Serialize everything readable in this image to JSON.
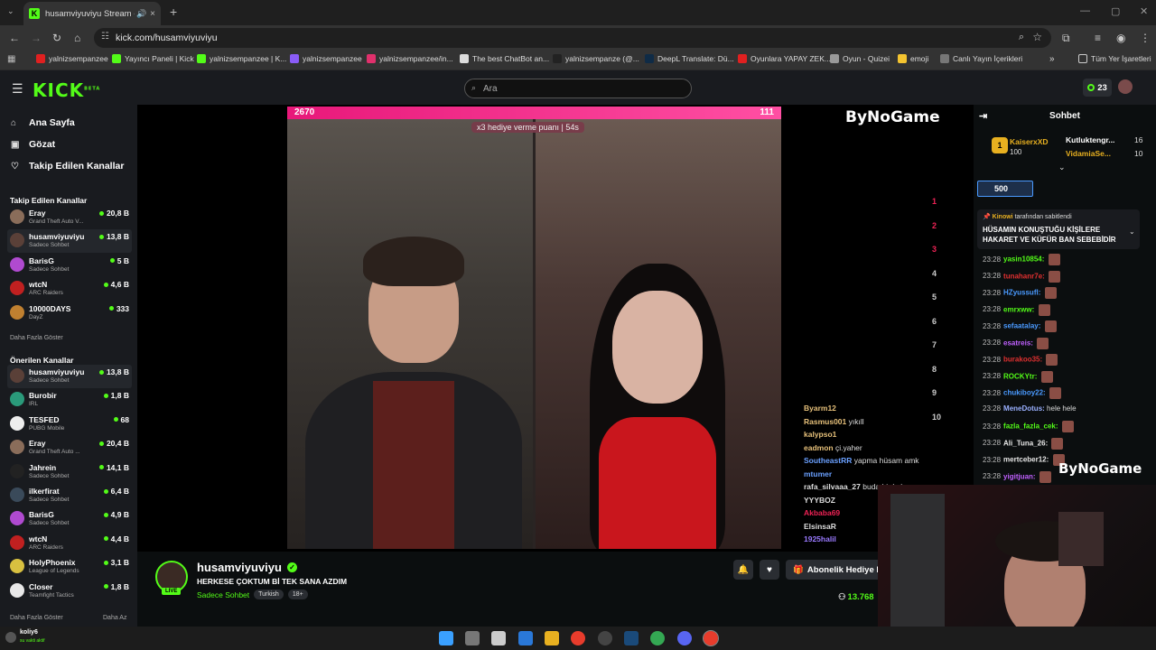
{
  "browser": {
    "tab_title": "husamviyuviyu Stream - W",
    "tab_close": "×",
    "new_tab": "+",
    "url": "kick.com/husamviyuviyu",
    "bookmarks": [
      {
        "label": "yalnizsempanzee",
        "color": "#e02020"
      },
      {
        "label": "Yayıncı Paneli | Kick",
        "color": "#53fc18"
      },
      {
        "label": "yalnizsempanzee | K...",
        "color": "#53fc18"
      },
      {
        "label": "yalnizsempanzee",
        "color": "#8a5cf6"
      },
      {
        "label": "yalnizsempanzee/in...",
        "color": "#e1306c"
      },
      {
        "label": "The best ChatBot an...",
        "color": "#dddddd"
      },
      {
        "label": "yalnizsempanze (@...",
        "color": "#222222"
      },
      {
        "label": "DeepL Translate: Dü...",
        "color": "#0f2b46"
      },
      {
        "label": "Oyunlara YAPAY ZEK...",
        "color": "#e02020"
      },
      {
        "label": "Oyun - Quizei",
        "color": "#999999"
      },
      {
        "label": "emoji",
        "color": "#f4c430"
      },
      {
        "label": "Canlı Yayın İçerikleri",
        "color": "#777777"
      }
    ],
    "all_bookmarks": "Tüm Yer İşaretleri"
  },
  "header": {
    "logo": "KICK",
    "search_placeholder": "Ara",
    "points": "23"
  },
  "sidebar": {
    "nav": [
      {
        "label": "Ana Sayfa",
        "icon": "home-icon"
      },
      {
        "label": "Gözat",
        "icon": "browse-icon"
      },
      {
        "label": "Takip Edilen Kanallar",
        "icon": "heart-icon"
      }
    ],
    "followed_title": "Takip Edilen Kanallar",
    "followed": [
      {
        "name": "Eray",
        "category": "Grand Theft Auto V...",
        "viewers": "20,8 B",
        "color": "#8a6d5a"
      },
      {
        "name": "husamviyuviyu",
        "category": "Sadece Sohbet",
        "viewers": "13,8 B",
        "color": "#5a4038"
      },
      {
        "name": "BarisG",
        "category": "Sadece Sohbet",
        "viewers": "5 B",
        "color": "#b04ad0"
      },
      {
        "name": "wtcN",
        "category": "ARC Raiders",
        "viewers": "4,6 B",
        "color": "#c02020"
      },
      {
        "name": "10000DAYS",
        "category": "DayZ",
        "viewers": "333",
        "color": "#c08030"
      }
    ],
    "followed_more": "Daha Fazla Göster",
    "recommended_title": "Önerilen Kanallar",
    "recommended": [
      {
        "name": "husamviyuviyu",
        "category": "Sadece Sohbet",
        "viewers": "13,8 B",
        "color": "#5a4038"
      },
      {
        "name": "Burobir",
        "category": "IRL",
        "viewers": "1,8 B",
        "color": "#2a9a7a"
      },
      {
        "name": "TESFED",
        "category": "PUBG Mobile",
        "viewers": "68",
        "color": "#eeeeee"
      },
      {
        "name": "Eray",
        "category": "Grand Theft Auto ...",
        "viewers": "20,4 B",
        "color": "#8a6d5a"
      },
      {
        "name": "Jahrein",
        "category": "Sadece Sohbet",
        "viewers": "14,1 B",
        "color": "#222222"
      },
      {
        "name": "ilkerfirat",
        "category": "Sadece Sohbet",
        "viewers": "6,4 B",
        "color": "#3a4a5a"
      },
      {
        "name": "BarisG",
        "category": "Sadece Sohbet",
        "viewers": "4,9 B",
        "color": "#b04ad0"
      },
      {
        "name": "wtcN",
        "category": "ARC Raiders",
        "viewers": "4,4 B",
        "color": "#c02020"
      },
      {
        "name": "HolyPhoenix",
        "category": "League of Legends",
        "viewers": "3,1 B",
        "color": "#d8c040"
      },
      {
        "name": "Closer",
        "category": "Teamfight Tactics",
        "viewers": "1,8 B",
        "color": "#e8e8e8"
      }
    ],
    "recommended_more": "Daha Fazla Göster",
    "less": "Daha Az"
  },
  "player": {
    "score_left": "2670",
    "score_right": "111",
    "banner": "x3 hediye verme puanı | 54s",
    "watermark": "ByNoGame",
    "overlay_chat": [
      {
        "user": "Byarm12",
        "text": "",
        "color": "#e6c07a"
      },
      {
        "user": "Rasmus001",
        "text": "yıkıll",
        "color": "#e6c07a"
      },
      {
        "user": "kalypso1",
        "text": "",
        "color": "#e6c07a"
      },
      {
        "user": "eadmon",
        "text": "çi.yaher",
        "color": "#e6c07a"
      },
      {
        "user": "SoutheastRR",
        "text": "yapma hüsam amk",
        "color": "#6aa0ff"
      },
      {
        "user": "mtumer",
        "text": "",
        "color": "#6aa0ff"
      },
      {
        "user": "rafa_silvaaa_27",
        "text": "buda bir kalp",
        "color": "#ddd"
      },
      {
        "user": "YYYBOZ",
        "text": "",
        "color": "#ddd"
      },
      {
        "user": "Akbaba69",
        "text": "",
        "color": "#e25"
      },
      {
        "user": "ElsinsaR",
        "text": "",
        "color": "#ddd"
      },
      {
        "user": "1925halil",
        "text": "",
        "color": "#9a7aff"
      }
    ],
    "ranks": [
      "1",
      "2",
      "3",
      "4",
      "5",
      "6",
      "7",
      "8",
      "9",
      "10"
    ]
  },
  "stream": {
    "channel": "husamviyuviyu",
    "live": "LIVE",
    "title": "HERKESE ÇOKTUM Bİ TEK SANA AZDIM",
    "category": "Sadece Sohbet",
    "tags": [
      "Turkish",
      "18+"
    ],
    "subscribe_gift": "Abonelik Hediye E",
    "viewers": "13.768"
  },
  "chat": {
    "title": "Sohbet",
    "leader": {
      "user": "KaiserxXD",
      "value": "100",
      "rank": "1"
    },
    "top": [
      {
        "user": "Kutluktengr...",
        "value": "16"
      },
      {
        "user": "VidamiaSe...",
        "value": "10"
      }
    ],
    "gift_box": "500",
    "pinned_by": "Kinowi",
    "pinned_by_suffix": "tarafından sabitlendi",
    "pinned_text": "HÜSAMIN KONUŞTUĞU KİŞİLERE HAKARET VE KÜFÜR BAN SEBEBİDİR",
    "messages": [
      {
        "time": "23:28",
        "user": "yasin10854:",
        "color": "#53fc18",
        "text": ""
      },
      {
        "time": "23:28",
        "user": "tunahanr7e:",
        "color": "#e03030",
        "text": ""
      },
      {
        "time": "23:28",
        "user": "HZyussufl:",
        "color": "#4a9aff",
        "text": ""
      },
      {
        "time": "23:28",
        "user": "emrxww:",
        "color": "#53fc18",
        "text": ""
      },
      {
        "time": "23:28",
        "user": "sefaatalay:",
        "color": "#4a9aff",
        "text": ""
      },
      {
        "time": "23:28",
        "user": "esatreis:",
        "color": "#c060ff",
        "text": ""
      },
      {
        "time": "23:28",
        "user": "burakoo35:",
        "color": "#e03030",
        "text": ""
      },
      {
        "time": "23:28",
        "user": "ROCKYtr:",
        "color": "#53fc18",
        "text": ""
      },
      {
        "time": "23:28",
        "user": "chukiboy22:",
        "color": "#4a9aff",
        "text": ""
      },
      {
        "time": "23:28",
        "user": "MeneDotus:",
        "color": "#9ab0ff",
        "text": "hele hele"
      },
      {
        "time": "23:28",
        "user": "fazla_fazla_cek:",
        "color": "#53fc18",
        "text": ""
      },
      {
        "time": "23:28",
        "user": "Ali_Tuna_26:",
        "color": "#e8e8e8",
        "text": ""
      },
      {
        "time": "23:28",
        "user": "mertceber12:",
        "color": "#e8e8e8",
        "text": ""
      },
      {
        "time": "23:28",
        "user": "yigitjuan:",
        "color": "#c060ff",
        "text": ""
      }
    ]
  },
  "taskbar": {
    "user": "koliy6",
    "status": "su vakti aktif"
  }
}
